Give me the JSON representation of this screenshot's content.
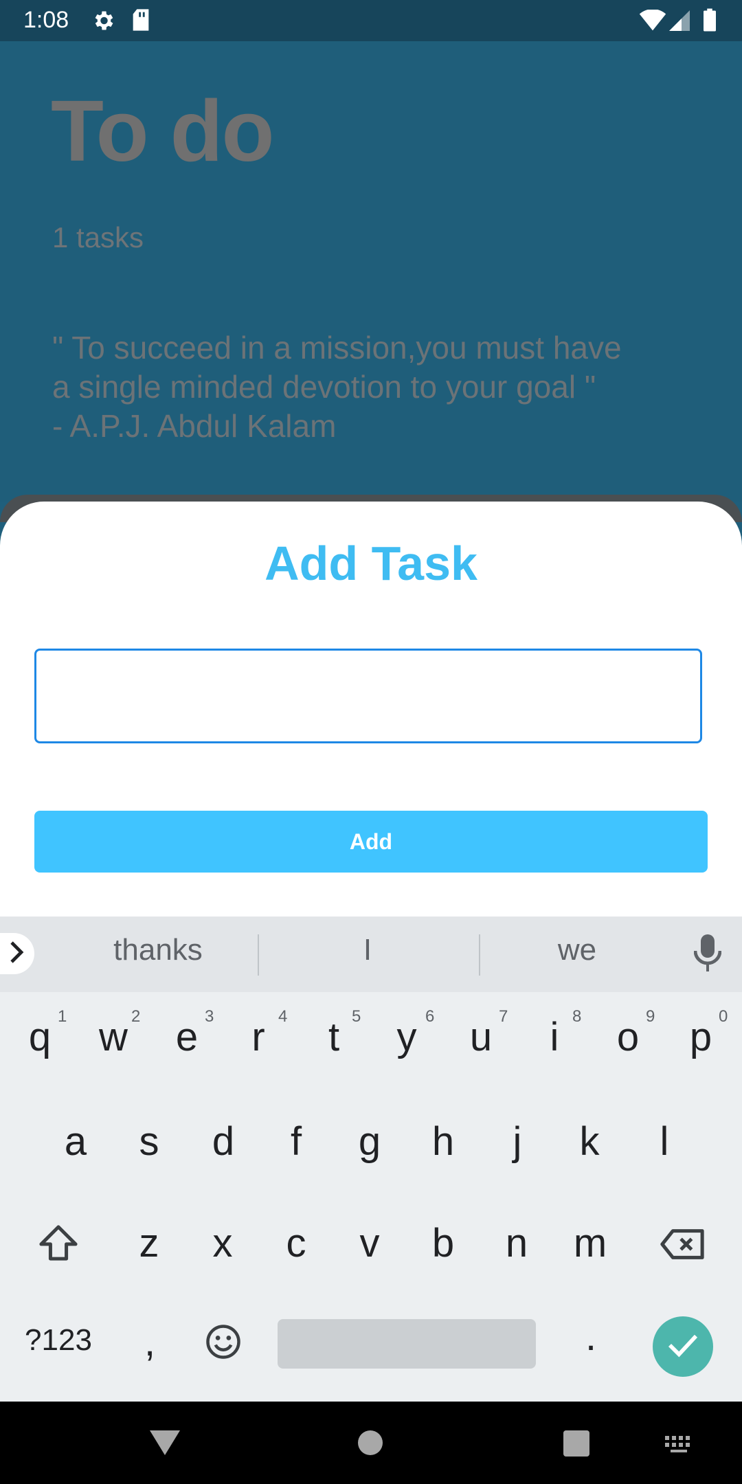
{
  "status_bar": {
    "time": "1:08",
    "icons": [
      "gear-icon",
      "sd-card-icon",
      "wifi-icon",
      "signal-icon",
      "battery-icon"
    ]
  },
  "app": {
    "title": "To do",
    "task_count": "1 tasks",
    "quote": "\" To succeed in a mission,you must have\na single minded devotion to your goal \"\n-  A.P.J. Abdul Kalam"
  },
  "sheet": {
    "title": "Add Task",
    "input_value": "",
    "add_button": "Add"
  },
  "keyboard": {
    "suggestions": [
      "thanks",
      "I",
      "we"
    ],
    "row1": [
      "q",
      "w",
      "e",
      "r",
      "t",
      "y",
      "u",
      "i",
      "o",
      "p"
    ],
    "row1_hints": [
      "1",
      "2",
      "3",
      "4",
      "5",
      "6",
      "7",
      "8",
      "9",
      "0"
    ],
    "row2": [
      "a",
      "s",
      "d",
      "f",
      "g",
      "h",
      "j",
      "k",
      "l"
    ],
    "row3": [
      "z",
      "x",
      "c",
      "v",
      "b",
      "n",
      "m"
    ],
    "symbols_key": "?123",
    "comma_key": ",",
    "period_key": "."
  },
  "colors": {
    "accent": "#40c4ff",
    "title_blue": "#3fbcf2",
    "app_background": "#1f5e7a",
    "enter_key": "#4db6ac"
  }
}
